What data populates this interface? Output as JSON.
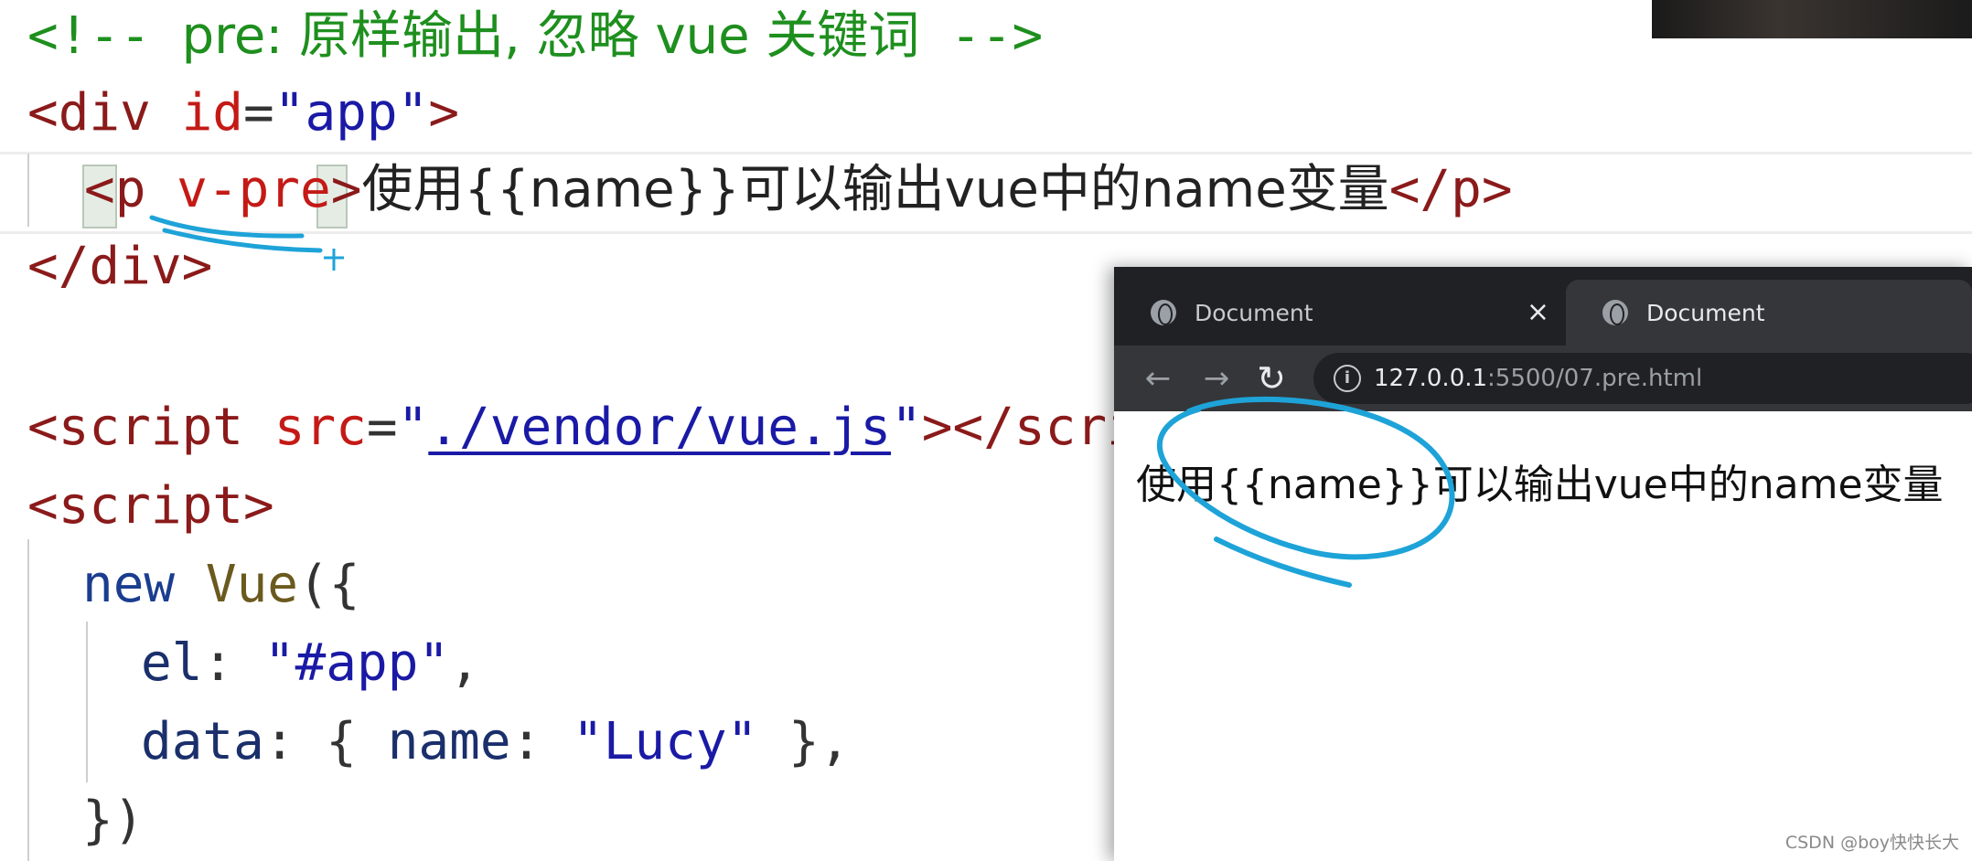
{
  "editor": {
    "line1": {
      "open": "<!-- ",
      "text": "pre: 原样输出, 忽略 vue 关键词",
      "close": " -->"
    },
    "line2": {
      "lt": "<",
      "tag": "div",
      "attr": "id",
      "eq": "=",
      "val": "\"app\"",
      "gt": ">"
    },
    "line3": {
      "lt": "<",
      "tag": "p",
      "attr": "v-pre",
      "gt": ">",
      "text": "使用{{name}}可以输出vue中的name变量",
      "close": "</p>"
    },
    "line4": {
      "close": "</div>"
    },
    "line5": {
      "lt": "<",
      "tag": "script",
      "attr": "src",
      "eq": "=",
      "q1": "\"",
      "src": "./vendor/vue.js",
      "q2": "\"",
      "rest": "></script"
    },
    "line6": {
      "open": "<script>"
    },
    "line7": {
      "kw": "new",
      "cls": "Vue",
      "punc": "({"
    },
    "line8": {
      "prop": "el",
      "colon": ": ",
      "val": "\"#app\"",
      "comma": ","
    },
    "line9": {
      "prop": "data",
      "colon": ": { ",
      "key": "name",
      "colon2": ": ",
      "val": "\"Lucy\"",
      "end": " },"
    },
    "line10": {
      "end": "})"
    }
  },
  "browser": {
    "tabs": [
      {
        "title": "Document",
        "close": "×"
      },
      {
        "title": "Document"
      }
    ],
    "nav": {
      "back": "←",
      "forward": "→",
      "reload": "↻"
    },
    "url": {
      "host": "127.0.0.1",
      "path": ":5500/07.pre.html"
    },
    "page_text": "使用{{name}}可以输出vue中的name变量"
  },
  "watermark": "CSDN @boy快快长大",
  "colors": {
    "annotation": "#1ea3d8",
    "tab_bg": "#202124",
    "toolbar_bg": "#35363a"
  }
}
